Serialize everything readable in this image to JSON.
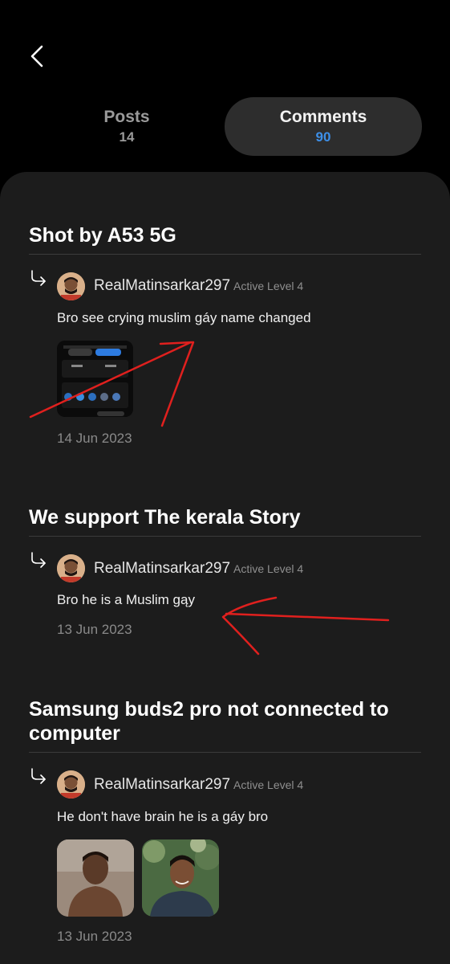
{
  "tabs": [
    {
      "label": "Posts",
      "count": "14"
    },
    {
      "label": "Comments",
      "count": "90"
    }
  ],
  "items": [
    {
      "post_title": "Shot by A53 5G",
      "username": "RealMatinsarkar297",
      "level": "Active Level 4",
      "comment": "Bro see crying muslim gáy name changed",
      "date": "14 Jun 2023"
    },
    {
      "post_title": "We support The kerala Story",
      "username": "RealMatinsarkar297",
      "level": "Active Level 4",
      "comment": "Bro he is a Muslim gąy",
      "date": "13 Jun 2023"
    },
    {
      "post_title": "Samsung buds2 pro not connected to computer",
      "username": "RealMatinsarkar297",
      "level": "Active Level 4",
      "comment": "He don't have brain he is a gáy bro",
      "date": "13 Jun 2023"
    }
  ],
  "icons": {
    "back": "chevron-left-icon",
    "reply": "reply-arrow-icon"
  },
  "colors": {
    "accent": "#3d8fe8",
    "background": "#000000",
    "panel": "#1c1c1c",
    "selected_tab": "#2d2d2d",
    "annotation": "#e0201e"
  }
}
